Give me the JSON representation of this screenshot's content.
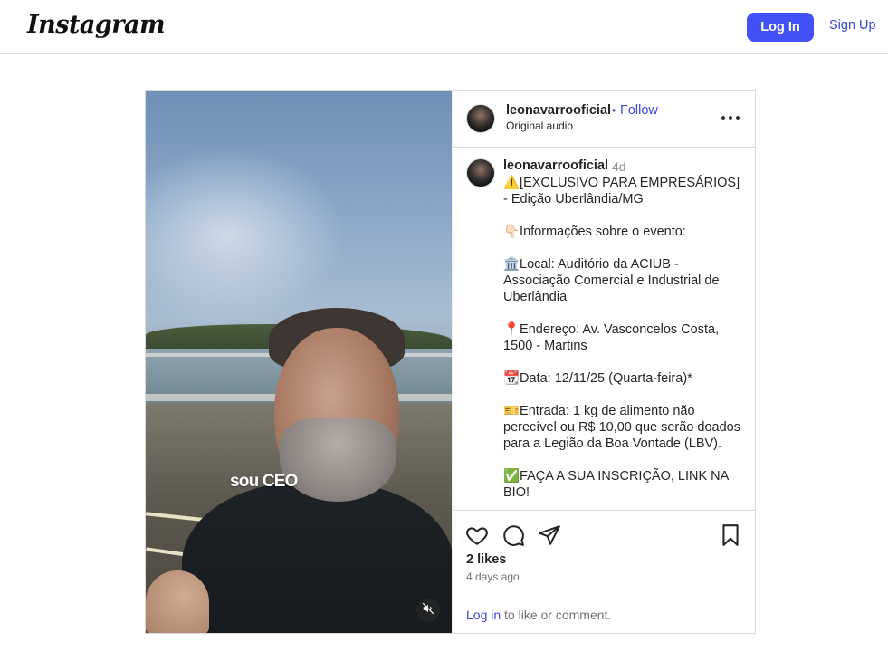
{
  "header": {
    "logo_text": "Instagram",
    "login_label": "Log In",
    "signup_label": "Sign Up"
  },
  "post": {
    "username": "leonavarrooficial",
    "dot": "•",
    "follow_label": "Follow",
    "audio_label": "Original audio",
    "video_caption_overlay": "sou CEO",
    "caption": {
      "username": "leonavarrooficial",
      "time": "4d",
      "lines": [
        "⚠️[EXCLUSIVO PARA EMPRESÁRIOS] - Edição Uberlândia/MG",
        "",
        "👇🏻Informações sobre o evento:",
        "",
        "🏛️Local: Auditório da ACIUB - Associação Comercial e Industrial de Uberlândia",
        "",
        "📍Endereço: Av. Vasconcelos Costa, 1500 - Martins",
        "",
        "📆Data: 12/11/25 (Quarta-feira)*",
        "",
        "🎫Entrada: 1 kg de alimento não perecível ou R$ 10,00 que serão doados para a Legião da Boa Vontade (LBV).",
        "",
        "✅FAÇA A SUA INSCRIÇÃO, LINK NA BIO!"
      ]
    },
    "likes": "2 likes",
    "posted_ago": "4 days ago",
    "login_prompt": {
      "link": "Log in",
      "rest": " to like or comment."
    }
  },
  "icons": {
    "like": "heart-icon",
    "comment": "comment-icon",
    "share": "share-icon",
    "save": "bookmark-icon",
    "more": "more-options-icon",
    "mute": "speaker-muted-icon"
  },
  "colors": {
    "accent": "#4150f7",
    "link": "#3b48d6",
    "border": "#dbdbdb",
    "muted_text": "#737373"
  }
}
